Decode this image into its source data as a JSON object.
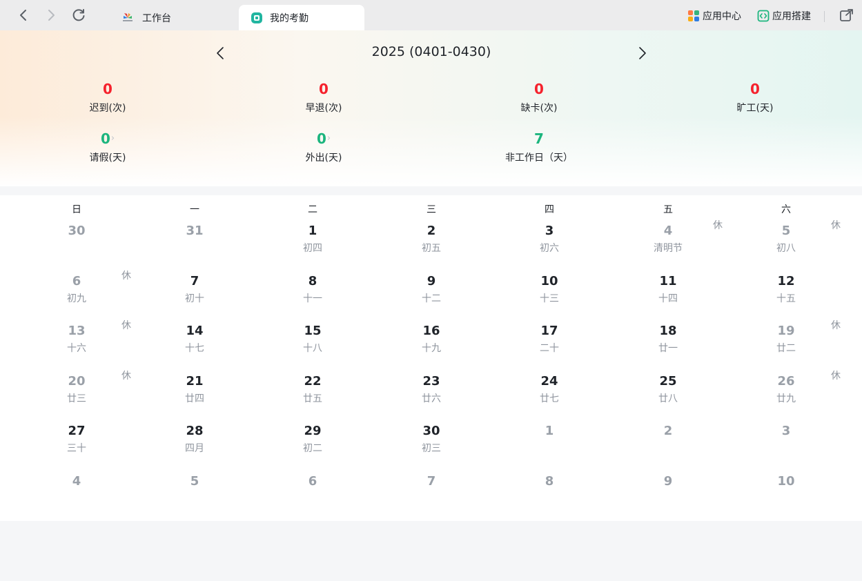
{
  "topbar": {
    "tabs": [
      {
        "label": "工作台",
        "active": false
      },
      {
        "label": "我的考勤",
        "active": true
      }
    ],
    "app_center": "应用中心",
    "app_builder": "应用搭建"
  },
  "summary": {
    "title": "2025 (0401-0430)",
    "stats": [
      {
        "value": "0",
        "label": "迟到(次)",
        "color": "red",
        "link": false
      },
      {
        "value": "0",
        "label": "早退(次)",
        "color": "red",
        "link": false
      },
      {
        "value": "0",
        "label": "缺卡(次)",
        "color": "red",
        "link": false
      },
      {
        "value": "0",
        "label": "旷工(天)",
        "color": "red",
        "link": false
      },
      {
        "value": "0",
        "label": "请假(天)",
        "color": "green",
        "link": true
      },
      {
        "value": "0",
        "label": "外出(天)",
        "color": "green",
        "link": true
      },
      {
        "value": "7",
        "label": "非工作日（天）",
        "color": "green",
        "link": false
      }
    ],
    "colors": {
      "red": "#f5222d",
      "green": "#1cb57e"
    }
  },
  "calendar": {
    "weekdays": [
      "日",
      "一",
      "二",
      "三",
      "四",
      "五",
      "六"
    ],
    "rest_label": "休",
    "weeks": [
      [
        {
          "day": "30",
          "lunar": "",
          "grey": true,
          "rest": false
        },
        {
          "day": "31",
          "lunar": "",
          "grey": true,
          "rest": false
        },
        {
          "day": "1",
          "lunar": "初四",
          "grey": false,
          "rest": false
        },
        {
          "day": "2",
          "lunar": "初五",
          "grey": false,
          "rest": false
        },
        {
          "day": "3",
          "lunar": "初六",
          "grey": false,
          "rest": false
        },
        {
          "day": "4",
          "lunar": "清明节",
          "grey": true,
          "rest": true
        },
        {
          "day": "5",
          "lunar": "初八",
          "grey": true,
          "rest": true
        }
      ],
      [
        {
          "day": "6",
          "lunar": "初九",
          "grey": true,
          "rest": true
        },
        {
          "day": "7",
          "lunar": "初十",
          "grey": false,
          "rest": false
        },
        {
          "day": "8",
          "lunar": "十一",
          "grey": false,
          "rest": false
        },
        {
          "day": "9",
          "lunar": "十二",
          "grey": false,
          "rest": false
        },
        {
          "day": "10",
          "lunar": "十三",
          "grey": false,
          "rest": false
        },
        {
          "day": "11",
          "lunar": "十四",
          "grey": false,
          "rest": false
        },
        {
          "day": "12",
          "lunar": "十五",
          "grey": false,
          "rest": false
        }
      ],
      [
        {
          "day": "13",
          "lunar": "十六",
          "grey": true,
          "rest": true
        },
        {
          "day": "14",
          "lunar": "十七",
          "grey": false,
          "rest": false
        },
        {
          "day": "15",
          "lunar": "十八",
          "grey": false,
          "rest": false
        },
        {
          "day": "16",
          "lunar": "十九",
          "grey": false,
          "rest": false
        },
        {
          "day": "17",
          "lunar": "二十",
          "grey": false,
          "rest": false
        },
        {
          "day": "18",
          "lunar": "廿一",
          "grey": false,
          "rest": false
        },
        {
          "day": "19",
          "lunar": "廿二",
          "grey": true,
          "rest": true
        }
      ],
      [
        {
          "day": "20",
          "lunar": "廿三",
          "grey": true,
          "rest": true
        },
        {
          "day": "21",
          "lunar": "廿四",
          "grey": false,
          "rest": false
        },
        {
          "day": "22",
          "lunar": "廿五",
          "grey": false,
          "rest": false
        },
        {
          "day": "23",
          "lunar": "廿六",
          "grey": false,
          "rest": false
        },
        {
          "day": "24",
          "lunar": "廿七",
          "grey": false,
          "rest": false
        },
        {
          "day": "25",
          "lunar": "廿八",
          "grey": false,
          "rest": false
        },
        {
          "day": "26",
          "lunar": "廿九",
          "grey": true,
          "rest": true
        }
      ],
      [
        {
          "day": "27",
          "lunar": "三十",
          "grey": false,
          "rest": false
        },
        {
          "day": "28",
          "lunar": "四月",
          "grey": false,
          "rest": false
        },
        {
          "day": "29",
          "lunar": "初二",
          "grey": false,
          "rest": false
        },
        {
          "day": "30",
          "lunar": "初三",
          "grey": false,
          "rest": false
        },
        {
          "day": "1",
          "lunar": "",
          "grey": true,
          "rest": false
        },
        {
          "day": "2",
          "lunar": "",
          "grey": true,
          "rest": false
        },
        {
          "day": "3",
          "lunar": "",
          "grey": true,
          "rest": false
        }
      ],
      [
        {
          "day": "4",
          "lunar": "",
          "grey": true,
          "rest": false
        },
        {
          "day": "5",
          "lunar": "",
          "grey": true,
          "rest": false
        },
        {
          "day": "6",
          "lunar": "",
          "grey": true,
          "rest": false
        },
        {
          "day": "7",
          "lunar": "",
          "grey": true,
          "rest": false
        },
        {
          "day": "8",
          "lunar": "",
          "grey": true,
          "rest": false
        },
        {
          "day": "9",
          "lunar": "",
          "grey": true,
          "rest": false
        },
        {
          "day": "10",
          "lunar": "",
          "grey": true,
          "rest": false
        }
      ]
    ]
  }
}
